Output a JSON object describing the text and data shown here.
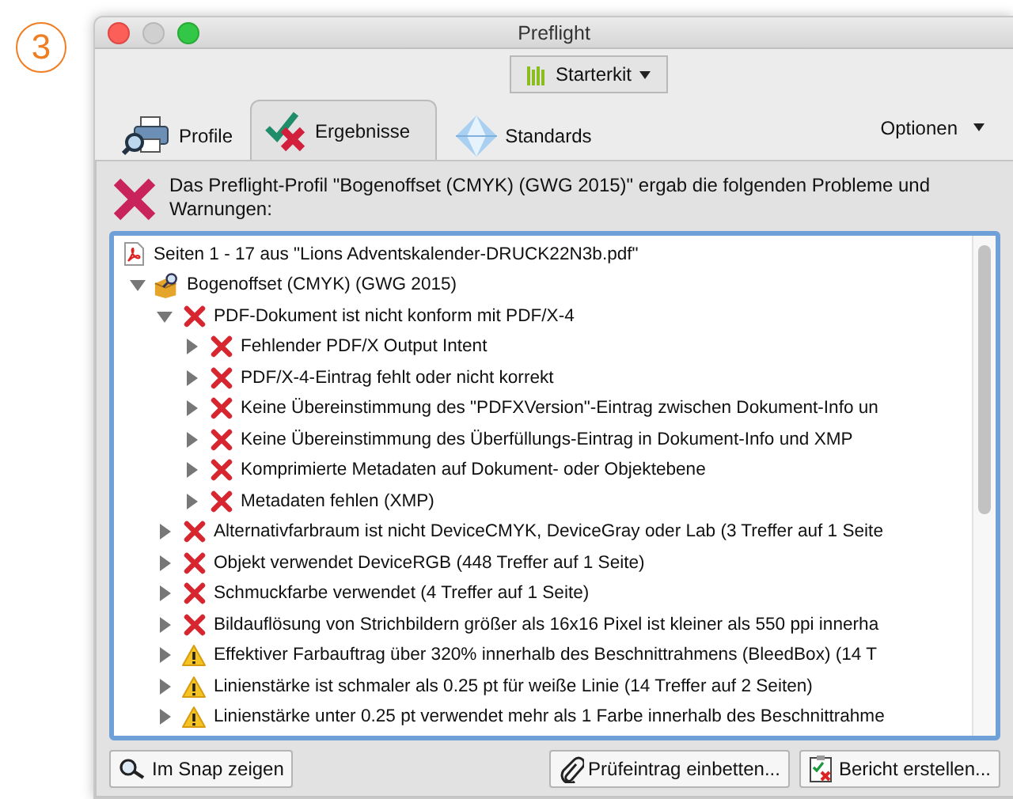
{
  "badge": "3",
  "window": {
    "title": "Preflight"
  },
  "library_button": {
    "label": "Starterkit"
  },
  "tabs": [
    {
      "label": "Profile",
      "kind": "profile",
      "selected": false
    },
    {
      "label": "Ergebnisse",
      "kind": "results",
      "selected": true
    },
    {
      "label": "Standards",
      "kind": "standards",
      "selected": false
    }
  ],
  "options_menu": {
    "label": "Optionen"
  },
  "summary": {
    "kind": "error",
    "text": "Das Preflight-Profil \"Bogenoffset (CMYK) (GWG 2015)\" ergab die folgenden Probleme und Warnungen:"
  },
  "tree": [
    {
      "kind": "document",
      "label": "Seiten 1 - 17 aus \"Lions Adventskalender-DRUCK22N3b.pdf\"",
      "children": [
        {
          "kind": "profile",
          "expanded": true,
          "label": "Bogenoffset (CMYK) (GWG 2015)",
          "children": [
            {
              "kind": "error",
              "expanded": true,
              "label": "PDF-Dokument ist nicht konform mit PDF/X-4",
              "children": [
                {
                  "kind": "error",
                  "expanded": false,
                  "label": "Fehlender PDF/X Output Intent"
                },
                {
                  "kind": "error",
                  "expanded": false,
                  "label": "PDF/X-4-Eintrag fehlt oder nicht korrekt"
                },
                {
                  "kind": "error",
                  "expanded": false,
                  "label": "Keine Übereinstimmung des \"PDFXVersion\"-Eintrag zwischen Dokument-Info un"
                },
                {
                  "kind": "error",
                  "expanded": false,
                  "label": "Keine Übereinstimmung des Überfüllungs-Eintrag in Dokument-Info und XMP"
                },
                {
                  "kind": "error",
                  "expanded": false,
                  "label": "Komprimierte Metadaten auf Dokument- oder Objektebene"
                },
                {
                  "kind": "error",
                  "expanded": false,
                  "label": "Metadaten fehlen (XMP)"
                }
              ]
            },
            {
              "kind": "error",
              "expanded": false,
              "label": "Alternativfarbraum ist nicht DeviceCMYK, DeviceGray oder Lab (3 Treffer auf 1 Seite"
            },
            {
              "kind": "error",
              "expanded": false,
              "label": "Objekt verwendet DeviceRGB (448 Treffer auf 1 Seite)"
            },
            {
              "kind": "error",
              "expanded": false,
              "label": "Schmuckfarbe verwendet (4 Treffer auf 1 Seite)"
            },
            {
              "kind": "error",
              "expanded": false,
              "label": "Bildauflösung von Strichbildern größer als 16x16 Pixel ist kleiner als 550 ppi innerha"
            },
            {
              "kind": "warning",
              "expanded": false,
              "label": "Effektiver Farbauftrag über 320% innerhalb des Beschnittrahmens (BleedBox) (14 T"
            },
            {
              "kind": "warning",
              "expanded": false,
              "label": "Linienstärke ist schmaler als 0.25 pt für weiße Linie (14 Treffer auf 2 Seiten)"
            },
            {
              "kind": "warning",
              "expanded": false,
              "label": "Linienstärke unter 0.25 pt verwendet mehr als 1 Farbe innerhalb des Beschnittrahme"
            }
          ]
        }
      ]
    }
  ],
  "buttons": [
    {
      "label": "Im Snap zeigen",
      "kind": "snap"
    },
    {
      "label": "Prüfeintrag einbetten...",
      "kind": "embed"
    },
    {
      "label": "Bericht erstellen...",
      "kind": "report"
    }
  ]
}
